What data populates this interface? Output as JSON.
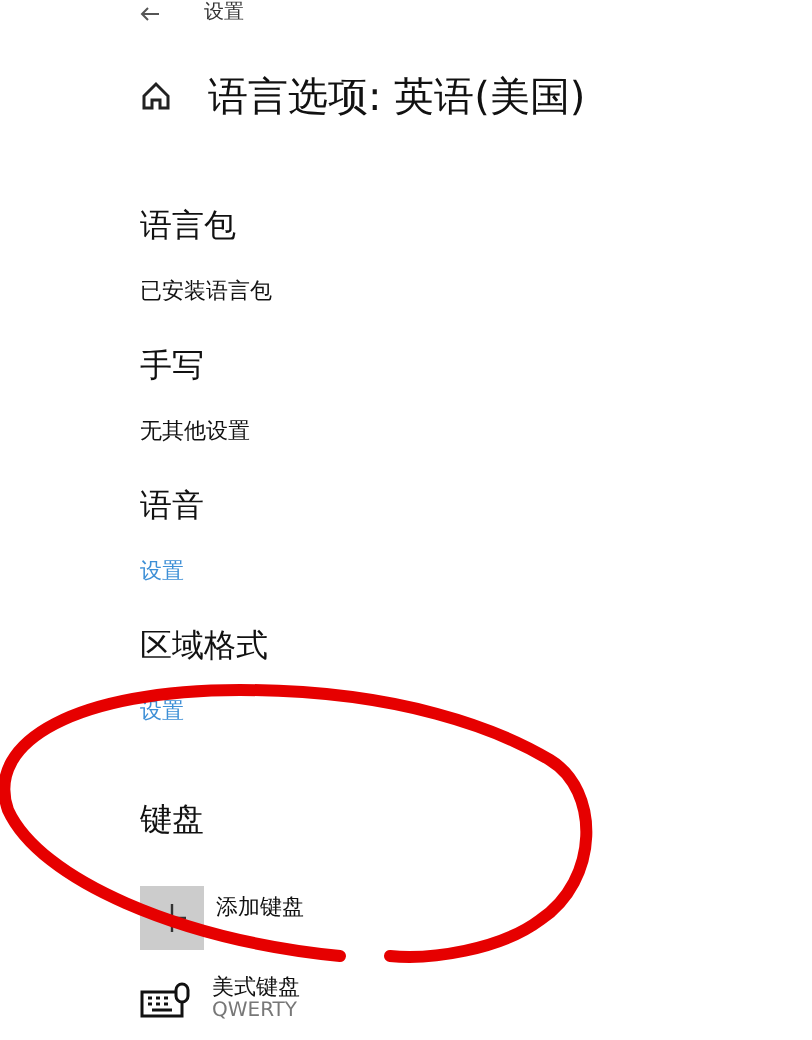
{
  "top_bar": {
    "title": "设置"
  },
  "page_title": "语言选项: 英语(美国)",
  "sections": [
    {
      "kind": "heading",
      "text": "语言包"
    },
    {
      "kind": "text",
      "text": "已安装语言包"
    },
    {
      "kind": "heading",
      "text": "手写"
    },
    {
      "kind": "text",
      "text": "无其他设置"
    },
    {
      "kind": "heading",
      "text": "语音"
    },
    {
      "kind": "link",
      "text": "设置"
    },
    {
      "kind": "heading",
      "text": "区域格式"
    },
    {
      "kind": "link",
      "text": "设置"
    }
  ],
  "keyboard": {
    "heading": "键盘",
    "items": [
      {
        "kind": "add",
        "label": "添加键盘"
      },
      {
        "kind": "keyboard",
        "label": "美式键盘",
        "detail": "QWERTY"
      }
    ]
  }
}
